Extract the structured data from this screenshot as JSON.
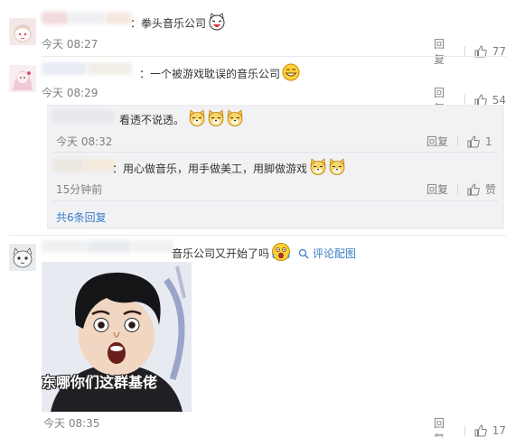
{
  "comments": [
    {
      "text": "：拳头音乐公司",
      "time": "今天 08:27",
      "reply_label": "回复",
      "likes": "77",
      "emoji": [
        "laughing-cat-emoji"
      ]
    },
    {
      "text": "：一个被游戏耽误的音乐公司",
      "time": "今天 08:29",
      "reply_label": "回复",
      "likes": "54",
      "emoji": [
        "grin-emoji"
      ]
    },
    {
      "text": "音乐公司又开始了吗",
      "time": "今天 08:35",
      "reply_label": "回复",
      "likes": "17",
      "emoji": [
        "shock-emoji"
      ],
      "image_link": "评论配图",
      "image_caption": "东哪你们这群基佬"
    }
  ],
  "replies": [
    {
      "text": "看透不说透。",
      "time": "今天 08:32",
      "reply_label": "回复",
      "likes": "1",
      "emoji": [
        "doge-emoji",
        "doge-emoji",
        "doge-emoji"
      ]
    },
    {
      "text": "：用心做音乐，用手做美工，用脚做游戏",
      "time": "15分钟前",
      "reply_label": "回复",
      "likes": "赞",
      "emoji": [
        "doge-emoji",
        "doge-emoji"
      ]
    }
  ],
  "reply_summary": "共6条回复",
  "colors": {
    "text": "#333333",
    "meta": "#808080",
    "link_orange": "#eb7350",
    "link_blue": "#3a7ec4",
    "reply_bg": "#f2f2f5"
  }
}
